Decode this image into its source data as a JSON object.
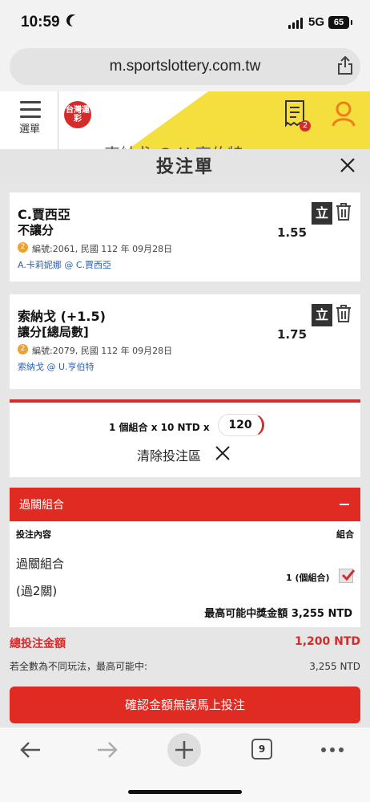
{
  "status_bar": {
    "time": "10:59",
    "network": "5G",
    "battery": "65"
  },
  "browser": {
    "url": "m.sportslottery.com.tw",
    "tabs_count": "9"
  },
  "site_header": {
    "menu_label": "選單",
    "logo_text": "台灣運彩",
    "cart_count": "2",
    "background_text": "索納戈 @ U.亨伯特"
  },
  "slip": {
    "title": "投注單",
    "selections": [
      {
        "name": "C.賈西亞",
        "market": "不讓分",
        "odds": "1.55",
        "badge": "2",
        "info": "編號:2061, 民國 112 年 09月28日",
        "match": "A.卡莉妮娜 @ C.賈西亞",
        "action_label": "立"
      },
      {
        "name": "索納戈 (+1.5)",
        "market": "讓分[總局數]",
        "odds": "1.75",
        "badge": "2",
        "info": "編號:2079, 民國 112 年 09月28日",
        "match": "索納戈 @ U.亨伯特",
        "action_label": "立"
      }
    ],
    "combo_line": "1 個組合 x 10 NTD x",
    "multiplier": "120",
    "clear_label": "清除投注區"
  },
  "parlay": {
    "header": "過關組合",
    "col_content": "投注內容",
    "col_combo": "組合",
    "name": "過關組合",
    "legs": "(過2關)",
    "count": "1 (個組合)",
    "checked": true,
    "max_label": "最高可能中獎金額",
    "max_value": "3,255 NTD"
  },
  "totals": {
    "total_label": "總投注金額",
    "total_value": "1,200 NTD",
    "note_label": "若全數為不同玩法，最高可能中:",
    "note_value": "3,255 NTD"
  },
  "confirm_label": "確認金額無誤馬上投注",
  "colors": {
    "accent": "#e02b22",
    "link": "#2a62b0",
    "brand_yellow": "#f5df3e"
  }
}
